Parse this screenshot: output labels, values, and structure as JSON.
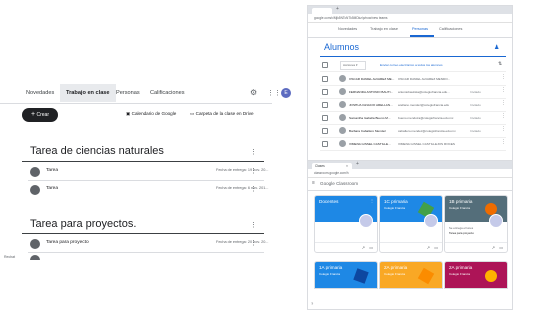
{
  "left": {
    "tabs": [
      "Novedades",
      "Trabajo en clase",
      "Personas",
      "Calificaciones"
    ],
    "avatar_letter": "E",
    "create_label": "Crear",
    "calendar_label": "Calendario de Google",
    "drive_label": "Carpeta de la clase en Drive",
    "sections": [
      {
        "title": "Tarea de ciencias naturales",
        "rows": [
          {
            "title": "Tarea",
            "due": "Fecha de entrega: 19 nov. 20..."
          },
          {
            "title": "Tarea",
            "due": "Fecha de entrega: 6 nov. 201..."
          }
        ]
      },
      {
        "title": "Tarea para proyectos.",
        "rows": [
          {
            "title": "Tarea para proyecto",
            "due": "Fecha de entrega: 20 nov. 20..."
          }
        ]
      }
    ],
    "corner_text": "Rechat"
  },
  "browser1": {
    "url": "google.com/c/Mjk5NTcNTk5MDkz/p/now/new  teams",
    "tabs": [
      "Novedades",
      "Trabajo en clase",
      "Personas",
      "Calificaciones"
    ],
    "heading": "Alumnos",
    "actions_label": "Acciones",
    "email_all": "Enviar correo electrónico a todos los alumnos",
    "students": [
      {
        "name": "OSCAR DANIEL ALVAREZ ME...",
        "email": "OSCAR DANIEL ALVAREZ MENDO...",
        "status": ""
      },
      {
        "name": "FERNANDA ANTONIO BAUTI...",
        "email": "antoniobautista@colegiofrancia.edu...",
        "status": "Invitado"
      },
      {
        "name": "JOSHUA IGNACIO ARELLAN...",
        "email": "arellano.mendez@colegiofrancia.edu",
        "status": "Invitado"
      },
      {
        "name": "Samantha Isabella Bueno M...",
        "email": "bueno.mendoza@colegiofrancia.edu.mx",
        "status": "Invitado"
      },
      {
        "name": "Barbara Caballero Mendez",
        "email": "caballero.mendez@colegiofrancia.edu.mx",
        "status": "Invitado"
      },
      {
        "name": "XIMENA GISSEL CASTILLE...",
        "email": "XIMENA GISSEL CASTILLEJOS ROCES",
        "status": ""
      }
    ]
  },
  "browser2": {
    "tab_label": "Clases",
    "url": "classroom.google.com/h",
    "app_title": "Google Classroom",
    "cards_top": [
      {
        "title": "Docentes",
        "sub": "",
        "color": "#1e88e5"
      },
      {
        "title": "1C primaria",
        "sub": "Colegio Francia",
        "color": "#1e88e5"
      },
      {
        "title": "1B primaria",
        "sub": "Colegio Francia",
        "color": "#546e7a"
      }
    ],
    "cards_bottom": [
      {
        "title": "1A primaria",
        "sub": "Colegio Francia",
        "color": "#1e88e5"
      },
      {
        "title": "2A primaria",
        "sub": "Colegio Francia",
        "color": "#f9a825"
      },
      {
        "title": "2A primaria",
        "sub": "Colegio Francia",
        "color": "#ad1457"
      }
    ],
    "card_snippet": "Tarea para proyecto",
    "card_snippet_due": "Se entrega el lunes"
  }
}
